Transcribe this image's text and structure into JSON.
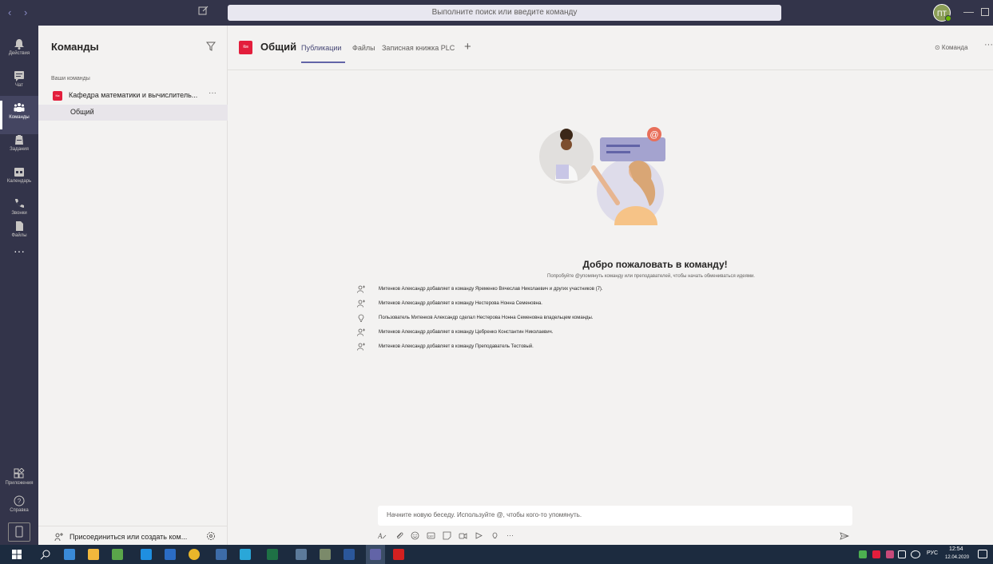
{
  "titlebar": {
    "search_placeholder": "Выполните поиск или введите команду",
    "avatar_initials": "ПТ",
    "nav_arrows": "‹ ›"
  },
  "appbar": {
    "items": [
      {
        "label": "Действия",
        "icon": "bell-icon"
      },
      {
        "label": "Чат",
        "icon": "chat-icon"
      },
      {
        "label": "Команды",
        "icon": "teams-icon",
        "active": true
      },
      {
        "label": "Задания",
        "icon": "assignments-icon"
      },
      {
        "label": "Календарь",
        "icon": "calendar-icon"
      },
      {
        "label": "Звонки",
        "icon": "phone-icon"
      },
      {
        "label": "Файлы",
        "icon": "files-icon"
      }
    ],
    "more": "···",
    "bottom_items": [
      {
        "label": "Приложения",
        "icon": "apps-icon"
      },
      {
        "label": "Справка",
        "icon": "help-icon"
      }
    ]
  },
  "teams_panel": {
    "title": "Команды",
    "section_label": "Ваши команды",
    "team": {
      "badge": "Км",
      "name": "Кафедра математики и вычислитель...",
      "more": "···"
    },
    "channel": "Общий",
    "join_label": "Присоединиться или создать ком..."
  },
  "channel_header": {
    "badge": "Км",
    "title": "Общий",
    "tabs": [
      "Публикации",
      "Файлы",
      "Записная книжка PLC"
    ],
    "add": "+",
    "team_button": "⊙ Команда",
    "more": "···"
  },
  "welcome": {
    "title": "Добро пожаловать в команду!",
    "subtitle": "Попробуйте @упомянуть команду или преподавателей, чтобы начать обмениваться идеями.",
    "events": [
      {
        "icon": "add-person-icon",
        "text": "Митенков Александр добавляет в команду Яременко Вячеслав Николаевич и других участников (7)."
      },
      {
        "icon": "add-person-icon",
        "text": "Митенков Александр добавляет в команду Нестерова Нонна Семеновна."
      },
      {
        "icon": "owner-icon",
        "text": "Пользователь Митенков Александр сделал Нестерова Нонна Семеновна владельцем команды."
      },
      {
        "icon": "add-person-icon",
        "text": "Митенков Александр добавляет в команду Цебренко Константин Николаевич."
      },
      {
        "icon": "add-person-icon",
        "text": "Митенков Александр добавляет в команду Преподаватель Тестовый."
      }
    ]
  },
  "compose": {
    "placeholder": "Начните новую беседу. Используйте @, чтобы кого-то упомянуть.",
    "toolbar_more": "···"
  },
  "taskbar": {
    "lang": "РУС",
    "time": "12:54",
    "date": "12.04.2020"
  },
  "colors": {
    "accent": "#6264a7",
    "rail": "#33344a",
    "team_badge": "#e31e3c",
    "taskbar": "#1c2b3f"
  }
}
